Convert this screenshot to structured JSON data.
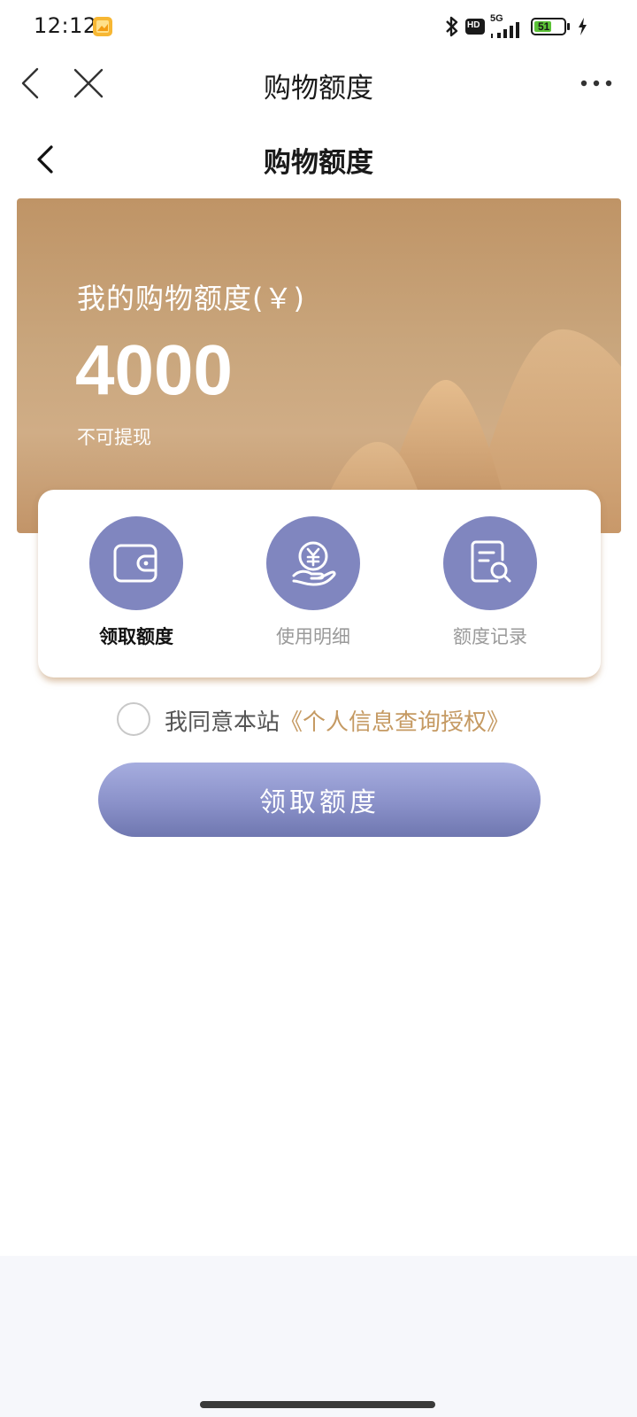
{
  "status_bar": {
    "time": "12:12",
    "hd_badge": "HD",
    "network": "5G",
    "battery_level": "51",
    "icons": [
      "gallery-app-icon",
      "bluetooth-icon",
      "hd-icon",
      "signal-icon",
      "battery-icon",
      "charging-icon"
    ]
  },
  "webview_bar": {
    "title": "购物额度",
    "icons": [
      "back-arrow-icon",
      "close-icon",
      "more-icon"
    ]
  },
  "page_header": {
    "title": "购物额度",
    "icons": [
      "back-chevron-icon"
    ]
  },
  "banner": {
    "label": "我的购物额度(￥)",
    "amount": "4000",
    "note": "不可提现"
  },
  "actions": [
    {
      "label": "领取额度",
      "icon": "wallet-icon",
      "active": true
    },
    {
      "label": "使用明细",
      "icon": "yuan-coin-hand-icon",
      "active": false
    },
    {
      "label": "额度记录",
      "icon": "document-search-icon",
      "active": false
    }
  ],
  "agreement": {
    "prefix": "我同意本站",
    "link": "《个人信息查询授权》",
    "checked": false
  },
  "primary_button": {
    "label": "领取额度"
  },
  "colors": {
    "banner": "#c49c70",
    "accent_link": "#c59a63",
    "icon_circle": "#8086bf",
    "button": "#8a91c9"
  }
}
